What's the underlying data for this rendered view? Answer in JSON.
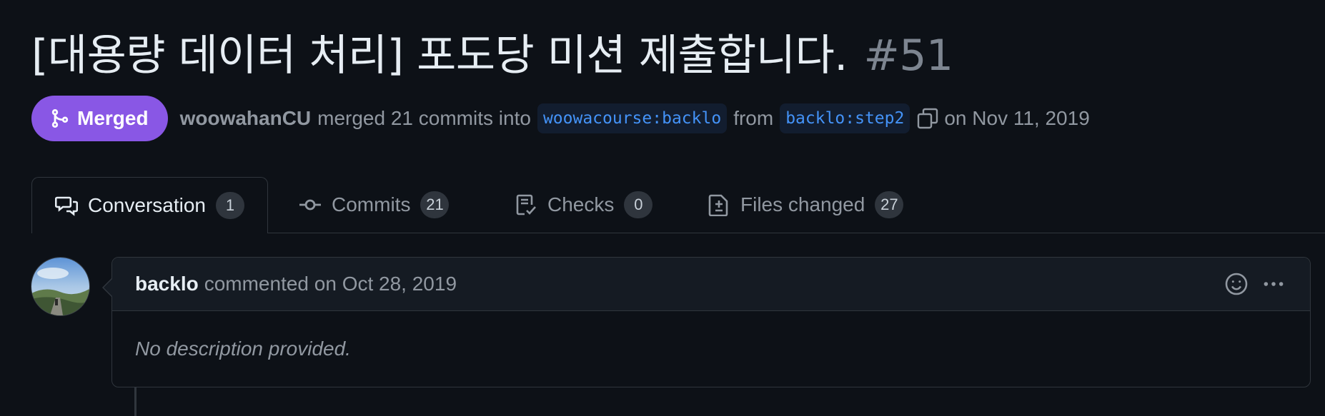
{
  "pr": {
    "title": "[대용량 데이터 처리] 포도당 미션 제출합니다.",
    "number": "#51",
    "state_label": "Merged",
    "author": "woowahanCU",
    "merged_text": "merged 21 commits into",
    "base_branch": "woowacourse:backlo",
    "from_text": "from",
    "head_branch": "backlo:step2",
    "date_text": "on Nov 11, 2019"
  },
  "tabs": [
    {
      "label": "Conversation",
      "count": "1",
      "icon": "comment-discussion-icon"
    },
    {
      "label": "Commits",
      "count": "21",
      "icon": "git-commit-icon"
    },
    {
      "label": "Checks",
      "count": "0",
      "icon": "checklist-icon"
    },
    {
      "label": "Files changed",
      "count": "27",
      "icon": "file-diff-icon"
    }
  ],
  "comment": {
    "author": "backlo",
    "meta": "commented on Oct 28, 2019",
    "body": "No description provided."
  },
  "colors": {
    "background": "#0d1117",
    "merged_badge": "#8957e5",
    "branch_text": "#4493f8",
    "border": "#30363d"
  }
}
